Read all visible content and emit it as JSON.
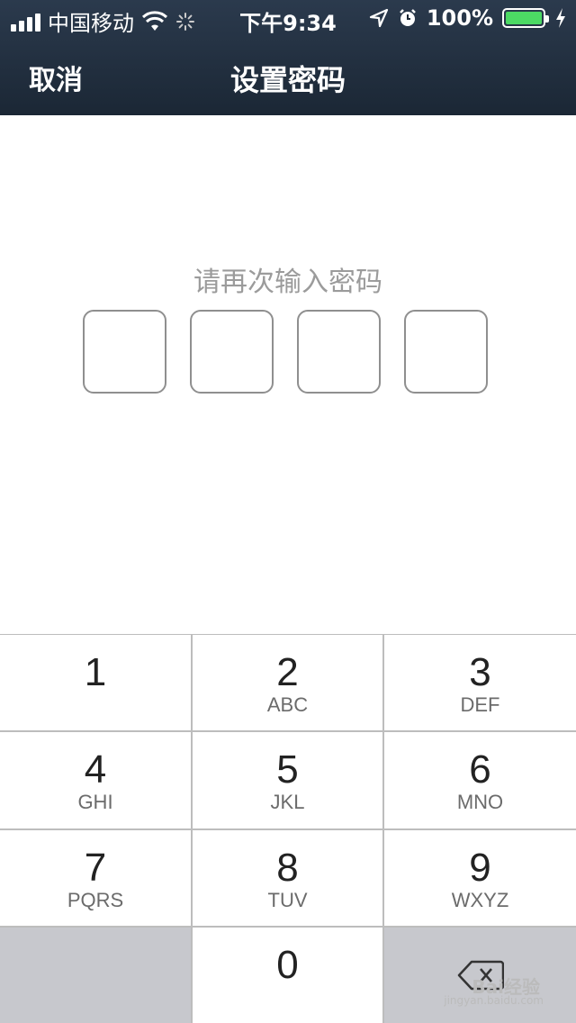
{
  "status_bar": {
    "carrier": "中国移动",
    "time": "下午9:34",
    "battery_text": "100%",
    "battery_level": 1.0,
    "battery_color": "#4cd964"
  },
  "nav": {
    "cancel_label": "取消",
    "title": "设置密码"
  },
  "main": {
    "prompt": "请再次输入密码",
    "pin_boxes": 4
  },
  "keypad": {
    "keys": [
      {
        "num": "1",
        "letters": ""
      },
      {
        "num": "2",
        "letters": "ABC"
      },
      {
        "num": "3",
        "letters": "DEF"
      },
      {
        "num": "4",
        "letters": "GHI"
      },
      {
        "num": "5",
        "letters": "JKL"
      },
      {
        "num": "6",
        "letters": "MNO"
      },
      {
        "num": "7",
        "letters": "PQRS"
      },
      {
        "num": "8",
        "letters": "TUV"
      },
      {
        "num": "9",
        "letters": "WXYZ"
      },
      {
        "num": "0",
        "letters": ""
      }
    ],
    "delete_icon": "backspace-icon"
  },
  "watermark": {
    "brand": "Bai经验",
    "url": "jingyan.baidu.com"
  }
}
